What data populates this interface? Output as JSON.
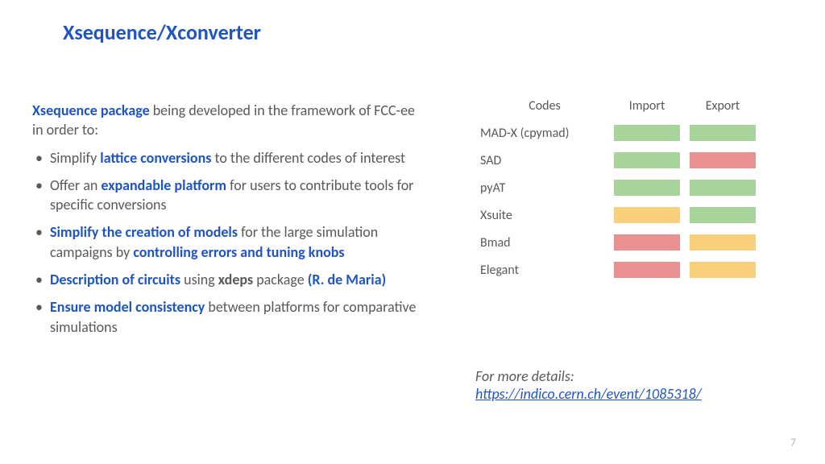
{
  "title": "Xsequence/Xconverter",
  "intro": {
    "lead": "Xsequence package",
    "rest": " being developed in the framework of FCC-ee in order to:"
  },
  "bullets": {
    "b1_pre": " Simplify ",
    "b1_em": "lattice conversions",
    "b1_post": " to the different codes of interest",
    "b2_pre": " Offer an ",
    "b2_em": "expandable platform",
    "b2_post": " for users to contribute tools for specific conversions",
    "b3_em1": "Simplify the creation of models",
    "b3_mid": " for the large simulation campaigns by ",
    "b3_em2": "controlling errors and tuning knobs",
    "b4_em1": "Description of circuits",
    "b4_mid": " using ",
    "b4_em2": "xdeps",
    "b4_post": " package ",
    "b4_em3": "(R. de Maria)",
    "b5_em": "Ensure model consistency",
    "b5_post": " between platforms for comparative simulations"
  },
  "table": {
    "h_codes": "Codes",
    "h_import": "Import",
    "h_export": "Export",
    "rows": [
      {
        "name": "MAD-X (cpymad)",
        "import": "g",
        "export": "g"
      },
      {
        "name": "SAD",
        "import": "g",
        "export": "r"
      },
      {
        "name": "pyAT",
        "import": "g",
        "export": "g"
      },
      {
        "name": "Xsuite",
        "import": "o",
        "export": "g"
      },
      {
        "name": "Bmad",
        "import": "r",
        "export": "o"
      },
      {
        "name": "Elegant",
        "import": "r",
        "export": "o"
      }
    ]
  },
  "details": {
    "lead": "For more details:",
    "url": "https://indico.cern.ch/event/1085318/"
  },
  "pagenum": "7",
  "chart_data": {
    "type": "table",
    "color_legend": {
      "g": "green",
      "o": "orange",
      "r": "red"
    },
    "columns": [
      "Codes",
      "Import",
      "Export"
    ],
    "rows": [
      [
        "MAD-X (cpymad)",
        "green",
        "green"
      ],
      [
        "SAD",
        "green",
        "red"
      ],
      [
        "pyAT",
        "green",
        "green"
      ],
      [
        "Xsuite",
        "orange",
        "green"
      ],
      [
        "Bmad",
        "red",
        "orange"
      ],
      [
        "Elegant",
        "red",
        "orange"
      ]
    ]
  }
}
